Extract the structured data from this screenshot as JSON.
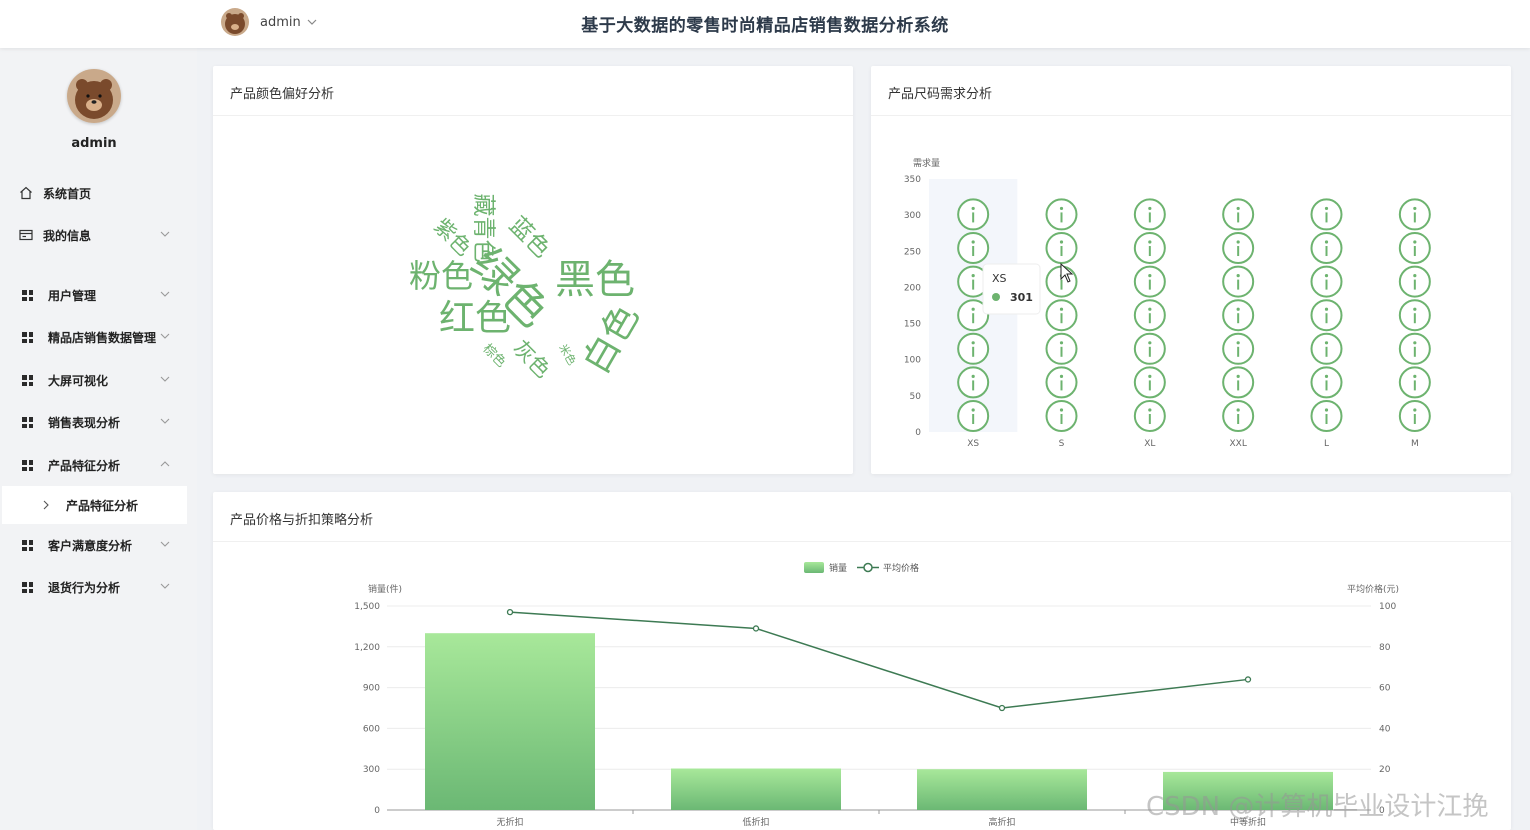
{
  "header": {
    "app_title": "基于大数据的零售时尚精品店销售数据分析系统",
    "user_name": "admin"
  },
  "sidebar": {
    "profile_name": "admin",
    "items": [
      {
        "label": "系统首页",
        "icon": "home-icon"
      },
      {
        "label": "我的信息",
        "icon": "id-card-icon"
      },
      {
        "label": "用户管理",
        "icon": "grid-icon"
      },
      {
        "label": "精品店销售数据管理",
        "icon": "grid-icon"
      },
      {
        "label": "大屏可视化",
        "icon": "grid-icon"
      },
      {
        "label": "销售表现分析",
        "icon": "grid-icon"
      },
      {
        "label": "产品特征分析",
        "icon": "grid-icon"
      },
      {
        "label": "客户满意度分析",
        "icon": "grid-icon"
      },
      {
        "label": "退货行为分析",
        "icon": "grid-icon"
      }
    ],
    "active_sub": "产品特征分析"
  },
  "cards": {
    "color_title": "产品颜色偏好分析",
    "size_title": "产品尺码需求分析",
    "price_title": "产品价格与折扣策略分析"
  },
  "watermark": "CSDN @计算机毕业设计江挽",
  "colors": {
    "accent_green": "#6db36f",
    "line_green": "#3d7a53",
    "bar_top": "#a8e89a",
    "bar_bottom": "#6bb874"
  },
  "chart_data": [
    {
      "type": "wordcloud",
      "title": "产品颜色偏好分析",
      "words": [
        {
          "text": "绿色",
          "weight": 10
        },
        {
          "text": "黑色",
          "weight": 9
        },
        {
          "text": "白色",
          "weight": 8
        },
        {
          "text": "红色",
          "weight": 8
        },
        {
          "text": "粉色",
          "weight": 7
        },
        {
          "text": "藏青色",
          "weight": 6
        },
        {
          "text": "蓝色",
          "weight": 5
        },
        {
          "text": "紫色",
          "weight": 4
        },
        {
          "text": "灰色",
          "weight": 4
        },
        {
          "text": "棕色",
          "weight": 2
        },
        {
          "text": "米色",
          "weight": 1
        }
      ]
    },
    {
      "type": "pictorial-bar",
      "title": "产品尺码需求分析",
      "ylabel": "需求量",
      "ylim": [
        0,
        350
      ],
      "yticks": [
        0,
        50,
        100,
        150,
        200,
        250,
        300,
        350
      ],
      "categories": [
        "XS",
        "S",
        "XL",
        "XXL",
        "L",
        "M"
      ],
      "values": [
        301,
        301,
        301,
        301,
        301,
        301
      ],
      "tooltip": {
        "category": "XS",
        "value": "301"
      }
    },
    {
      "type": "bar-line",
      "title": "产品价格与折扣策略分析",
      "categories": [
        "无折扣",
        "低折扣",
        "高折扣",
        "中等折扣"
      ],
      "series": [
        {
          "name": "销量",
          "type": "bar",
          "axis": "left",
          "values": [
            1300,
            305,
            300,
            280
          ]
        },
        {
          "name": "平均价格",
          "type": "line",
          "axis": "right",
          "values": [
            97,
            89,
            50,
            64
          ]
        }
      ],
      "ylabel_left": "销量(件)",
      "ylabel_right": "平均价格(元)",
      "ylim_left": [
        0,
        1500
      ],
      "ylim_right": [
        0,
        100
      ],
      "yticks_left": [
        "0",
        "300",
        "600",
        "900",
        "1,200",
        "1,500"
      ],
      "yticks_right": [
        "0",
        "20",
        "40",
        "60",
        "80",
        "100"
      ],
      "legend": "top-center"
    }
  ]
}
